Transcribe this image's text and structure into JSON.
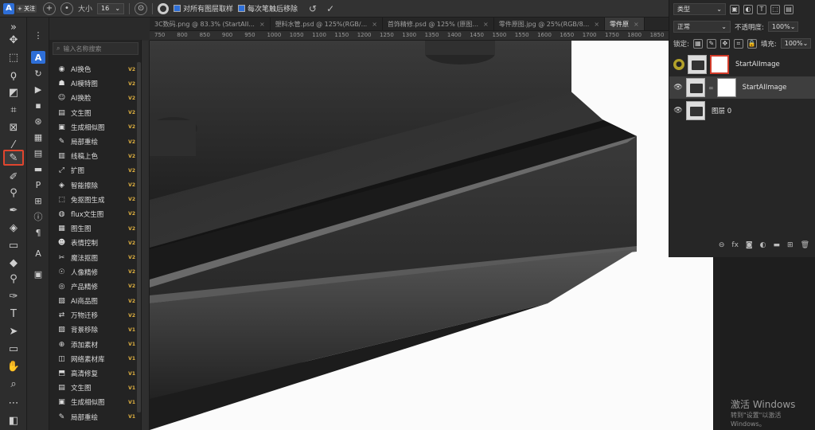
{
  "options_bar": {
    "follow_label": "+ 关注",
    "size_label": "大小",
    "size_value": "16",
    "sample_all_label": "对所有图层取样",
    "remove_after_label": "每次笔触后移除"
  },
  "tabs": [
    {
      "label": "3C数码.png @ 83.3% (StartAII..."
    },
    {
      "label": "塑料水管.psd @ 125%(RGB/..."
    },
    {
      "label": "首饰精修.psd @ 125% (原图..."
    },
    {
      "label": "零件原图.jpg @ 25%(RGB/8..."
    },
    {
      "label": "零件原"
    }
  ],
  "ruler_ticks": [
    "750",
    "800",
    "850",
    "900",
    "950",
    "1000",
    "1050",
    "1100",
    "1150",
    "1200",
    "1250",
    "1300",
    "1350",
    "1400",
    "1450",
    "1500",
    "1550",
    "1600",
    "1650",
    "1700",
    "1750",
    "1800",
    "1850"
  ],
  "plugin": {
    "search_placeholder": "输入名称搜索",
    "items": [
      {
        "icon": "face-swap-icon",
        "label": "AI换色",
        "ver": "V2"
      },
      {
        "icon": "model-icon",
        "label": "AI模特图",
        "ver": "V2"
      },
      {
        "icon": "face-icon",
        "label": "AI换脸",
        "ver": "V2"
      },
      {
        "icon": "text-image-icon",
        "label": "文生图",
        "ver": "V2"
      },
      {
        "icon": "similar-icon",
        "label": "生成相似图",
        "ver": "V2"
      },
      {
        "icon": "brush-icon",
        "label": "局部重绘",
        "ver": "V2"
      },
      {
        "icon": "line-color-icon",
        "label": "线稿上色",
        "ver": "V2"
      },
      {
        "icon": "expand-icon",
        "label": "扩图",
        "ver": "V2"
      },
      {
        "icon": "erase-icon",
        "label": "智能擦除",
        "ver": "V2"
      },
      {
        "icon": "cutout-icon",
        "label": "免抠图生成",
        "ver": "V2"
      },
      {
        "icon": "flux-icon",
        "label": "flux文生图",
        "ver": "V2"
      },
      {
        "icon": "img2img-icon",
        "label": "图生图",
        "ver": "V2"
      },
      {
        "icon": "emotion-icon",
        "label": "表情控制",
        "ver": "V2"
      },
      {
        "icon": "magic-cutout-icon",
        "label": "魔法抠图",
        "ver": "V2"
      },
      {
        "icon": "portrait-icon",
        "label": "人像精修",
        "ver": "V2"
      },
      {
        "icon": "product-icon",
        "label": "产品精修",
        "ver": "V2"
      },
      {
        "icon": "product-image-icon",
        "label": "AI商品图",
        "ver": "V2"
      },
      {
        "icon": "transfer-icon",
        "label": "万物迁移",
        "ver": "V2"
      },
      {
        "icon": "bg-remove-icon",
        "label": "背景移除",
        "ver": "V1"
      },
      {
        "icon": "add-material-icon",
        "label": "添加素材",
        "ver": "V1"
      },
      {
        "icon": "library-icon",
        "label": "网络素材库",
        "ver": "V1"
      },
      {
        "icon": "hd-icon",
        "label": "高清修复",
        "ver": "V1"
      },
      {
        "icon": "text-image-icon",
        "label": "文生图",
        "ver": "V1"
      },
      {
        "icon": "similar-icon",
        "label": "生成相似图",
        "ver": "V1"
      },
      {
        "icon": "brush-icon",
        "label": "局部重绘",
        "ver": "V1"
      }
    ]
  },
  "layers_panel": {
    "kind_label": "类型",
    "blend_mode": "正常",
    "opacity_label": "不透明度:",
    "opacity_value": "100%",
    "lock_label": "锁定:",
    "fill_label": "填充:",
    "fill_value": "100%",
    "layers": [
      {
        "name": "StartAIImage"
      },
      {
        "name": "StartAIImage"
      },
      {
        "name": "图层 0"
      }
    ]
  },
  "watermark": {
    "line1": "激活 Windows",
    "line2": "转到\"设置\"以激活 Windows。"
  },
  "colors": {
    "accent": "#2e6fd8",
    "highlight_red": "#d23c2a",
    "version_gold": "#e3b341"
  }
}
